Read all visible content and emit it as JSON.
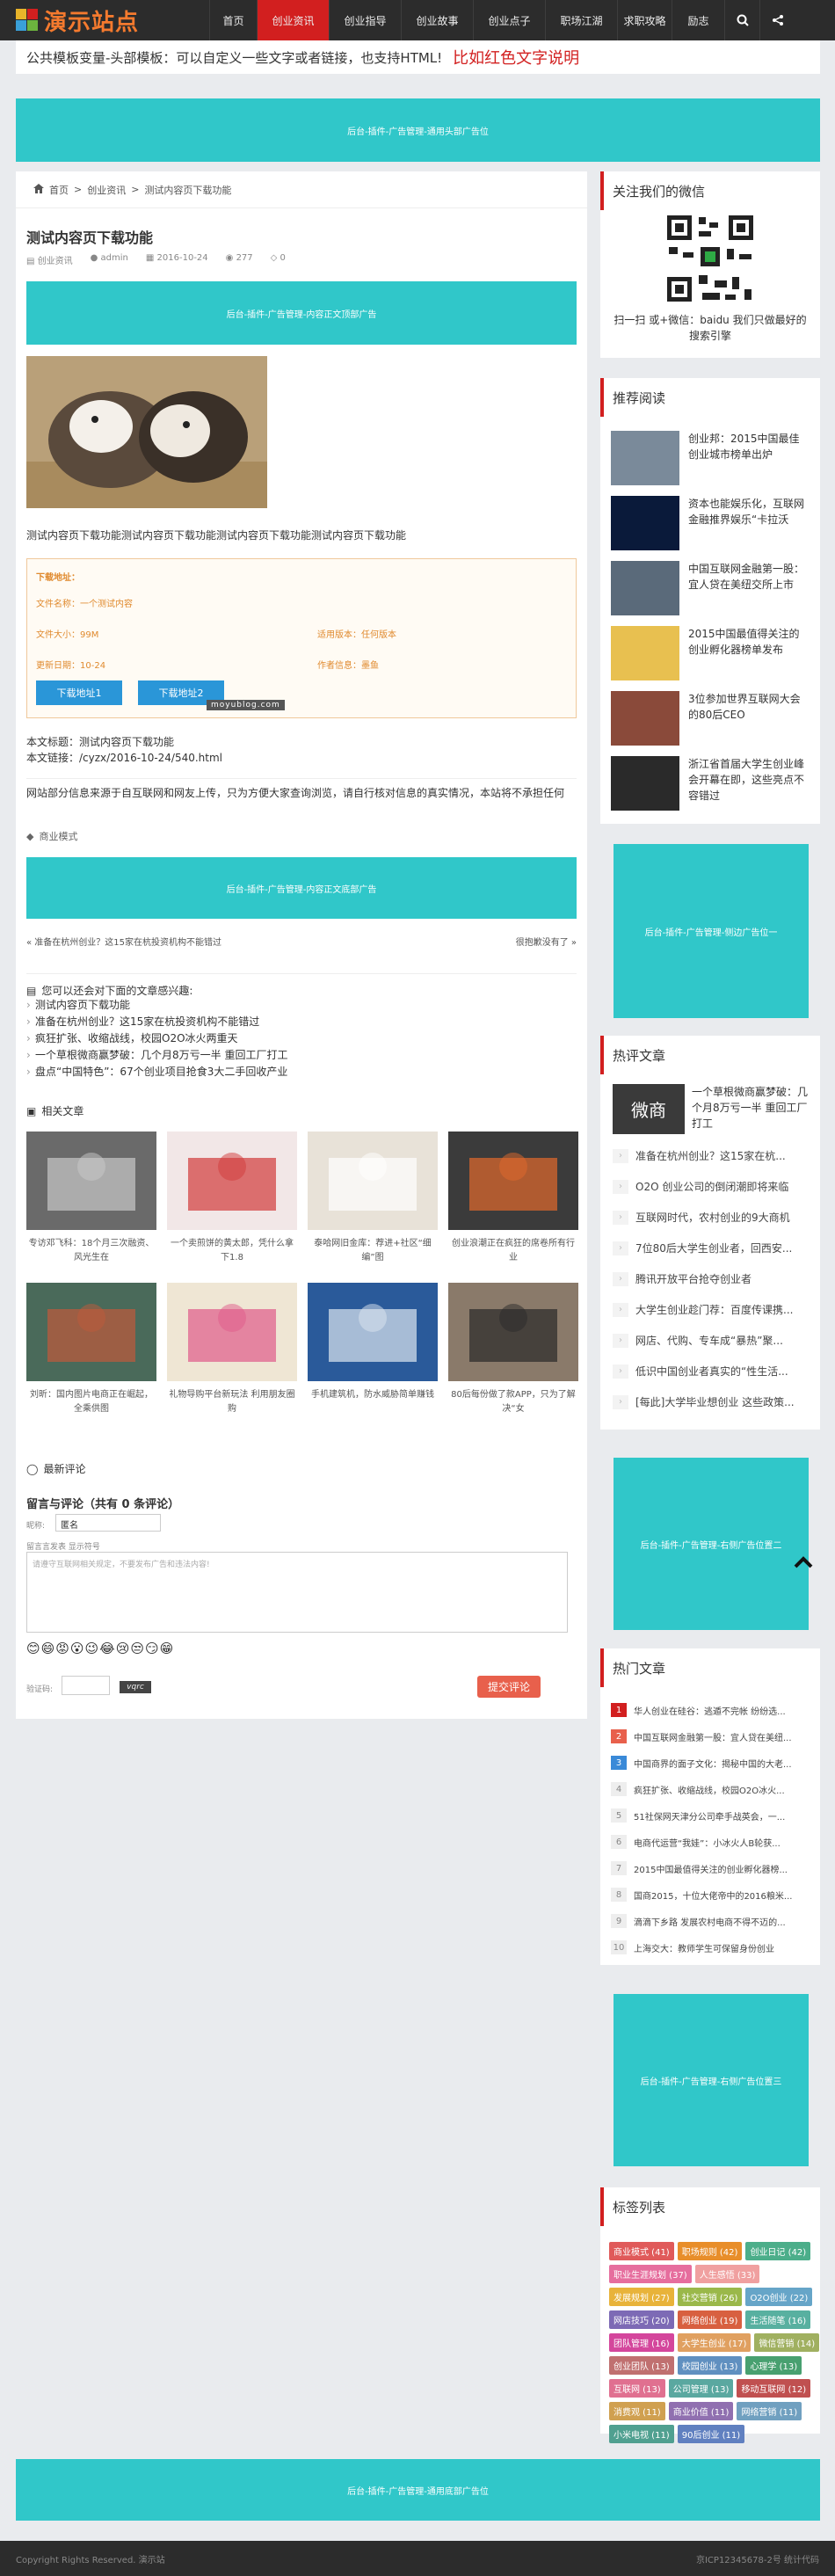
{
  "header": {
    "logo_text": "演示站点",
    "nav": [
      "首页",
      "创业资讯",
      "创业指导",
      "创业故事",
      "创业点子",
      "职场江湖",
      "求职攻略",
      "励志"
    ],
    "nav_active_index": 1
  },
  "notice": {
    "text": "公共模板变量-头部模板：可以自定义一些文字或者链接，也支持HTML!",
    "red_text": "比如红色文字说明"
  },
  "ads": {
    "top": "后台-插件-广告管理-通用头部广告位",
    "content_top": "后台-插件-广告管理-内容正文顶部广告",
    "content_bottom": "后台-插件-广告管理-内容正文底部广告",
    "right1": "后台-插件-广告管理-侧边广告位一",
    "right2": "后台-插件-广告管理-右侧广告位置二",
    "right3": "后台-插件-广告管理-右侧广告位置三",
    "footer": "后台-插件-广告管理-通用底部广告位"
  },
  "breadcrumb": {
    "home": "首页",
    "cat": "创业资讯",
    "current": "测试内容页下载功能"
  },
  "article": {
    "title": "测试内容页下载功能",
    "meta_cat": "创业资讯",
    "meta_author": "admin",
    "meta_date": "2016-10-24",
    "meta_views": "277",
    "meta_comments": "0",
    "body": "测试内容页下载功能测试内容页下载功能测试内容页下载功能测试内容页下载功能",
    "download": {
      "heading": "下载地址：",
      "name": "文件名称：一个测试内容",
      "size": "文件大小：99M",
      "version": "适用版本：任何版本",
      "updated": "更新日期：10-24",
      "author": "作者信息：墨鱼",
      "btn1": "下载地址1",
      "btn2": "下载地址2",
      "watermark": "moyublog.com"
    },
    "source_title": "本文标题：测试内容页下载功能",
    "source_link": "本文链接：/cyzx/2016-10-24/540.html",
    "disclaimer": "网站部分信息来源于自互联网和网友上传，只为方便大家查询浏览，请自行核对信息的真实情况，本站将不承担任何",
    "tag": "商业模式",
    "prev": "« 准备在杭州创业？这15家在杭投资机构不能错过",
    "next": "很抱歉没有了 »"
  },
  "interest": {
    "title": "您可以还会对下面的文章感兴趣:",
    "items": [
      "测试内容页下载功能",
      "准备在杭州创业？这15家在杭投资机构不能错过",
      "疯狂扩张、收缩战线，校园O2O冰火两重天",
      "一个草根微商赢梦破：几个月8万亏一半 重回工厂打工",
      "盘点“中国特色”：67个创业项目抢食3大二手回收产业"
    ]
  },
  "related": {
    "title": "相关文章",
    "items": [
      "专访邓飞科：18个月三次融资、风光生在",
      "一个卖煎饼的黄太郎，凭什么拿下1.8",
      "泰哈网旧金库：荐进+社区“细编”图",
      "创业浪潮正在疯狂的席卷所有行业",
      "刘昕：国内图片电商正在崛起，全乘供图",
      "礼物导购平台新玩法 利用朋友圈购",
      "手机建筑机，防水威胁简单赚钱",
      "80后每份做了款APP，只为了解决“女"
    ]
  },
  "comment": {
    "title": "最新评论",
    "heading": "留言与评论（共有 0 条评论）",
    "nick_label": "昵称:",
    "nick_value": "匿名",
    "hint": "请遵守互联网相关规定，不要发布广告和违法内容!",
    "content_label": "留言言发表 显示符号",
    "captcha_label": "验证码:",
    "captcha_img": "vqrc",
    "submit": "提交评论"
  },
  "sidebar": {
    "wechat_title": "关注我们的微信",
    "wechat_text": "扫一扫 或+微信：baidu 我们只做最好的搜索引擎",
    "recommend_title": "推荐阅读",
    "recommend": [
      "创业邦：2015中国最佳创业城市榜单出炉",
      "资本也能娱乐化，互联网金融推界娱乐“卡拉沃",
      "中国互联网金融第一股：宜人贷在美纽交所上市",
      "2015中国最值得关注的创业孵化器榜单发布",
      "3位参加世界互联网大会的80后CEO",
      "浙江省首届大学生创业峰会开幕在即，这些亮点不容错过"
    ],
    "hot_title": "热评文章",
    "hot_top": "一个草根微商赢梦破：几个月8万亏一半 重回工厂打工",
    "hot_top_img": "微商",
    "hot": [
      "准备在杭州创业？这15家在杭...",
      "O2O 创业公司的倒闭潮即将来临",
      "互联网时代，农村创业的9大商机",
      "7位80后大学生创业者，回西安...",
      "腾讯开放平台抢夺创业者",
      "大学生创业趁门荐：百度传课携...",
      "网店、代购、专车成“暴热”聚...",
      "低识中国创业者真实的“性生活...",
      "[每此]大学毕业想创业 这些政策..."
    ],
    "popular_title": "热门文章",
    "popular": [
      "华人创业在硅谷：逃遁不完帐 纷纷选...",
      "中国互联网金融第一股：宜人贷在美纽...",
      "中国商界的面子文化：揭秘中国的大老...",
      "疯狂扩张、收缩战线，校园O2O冰火...",
      "51社保网天津分公司牵手战英会，一...",
      "电商代运营“我娃”：小冰火人B轮获...",
      "2015中国最值得关注的创业孵化器榜...",
      "国商2015，十位大佬帝中的2016粮米...",
      "滴滴下乡路 发展农村电商不得不迈的...",
      "上海交大：教师学生可保留身份创业"
    ],
    "tags_title": "标签列表",
    "tags": [
      "商业模式 (41)",
      "职场规则 (42)",
      "创业日记 (42)",
      "职业生涯规划 (37)",
      "人生感悟 (33)",
      "发展规划 (27)",
      "社交营销 (26)",
      "O2O创业 (22)",
      "网店技巧 (20)",
      "网络创业 (19)",
      "生活随笔 (16)",
      "团队管理 (16)",
      "大学生创业 (17)",
      "微信营销 (14)",
      "创业团队 (13)",
      "校园创业 (13)",
      "心理学 (13)",
      "互联网 (13)",
      "公司管理 (13)",
      "移动互联网 (12)",
      "消费观 (11)",
      "商业价值 (11)",
      "网络营销 (11)",
      "小米电视 (11)",
      "90后创业 (11)"
    ],
    "tag_colors": [
      "#e05a5a",
      "#e88e2a",
      "#4cae8a",
      "#e66e9e",
      "#f0a0a0",
      "#e8b33a",
      "#9ab84a",
      "#66a5c8",
      "#7d6ab5",
      "#d86040",
      "#58b0a0",
      "#d4469c",
      "#e0a060",
      "#a0b060",
      "#c07070",
      "#6090c0",
      "#48a070",
      "#e07090",
      "#5aa8a0",
      "#c05050",
      "#d0a050",
      "#9070b0",
      "#70a0c0",
      "#50a090",
      "#6080c0"
    ]
  },
  "footer": {
    "copyright": "Copyright Rights Reserved. 演示站",
    "icp": "京ICP12345678-2号  统计代码"
  },
  "colors": {
    "accent": "#d21f1f",
    "teal": "#30c7c9",
    "download_btn": "#2a96d8",
    "submit": "#e8604c"
  }
}
